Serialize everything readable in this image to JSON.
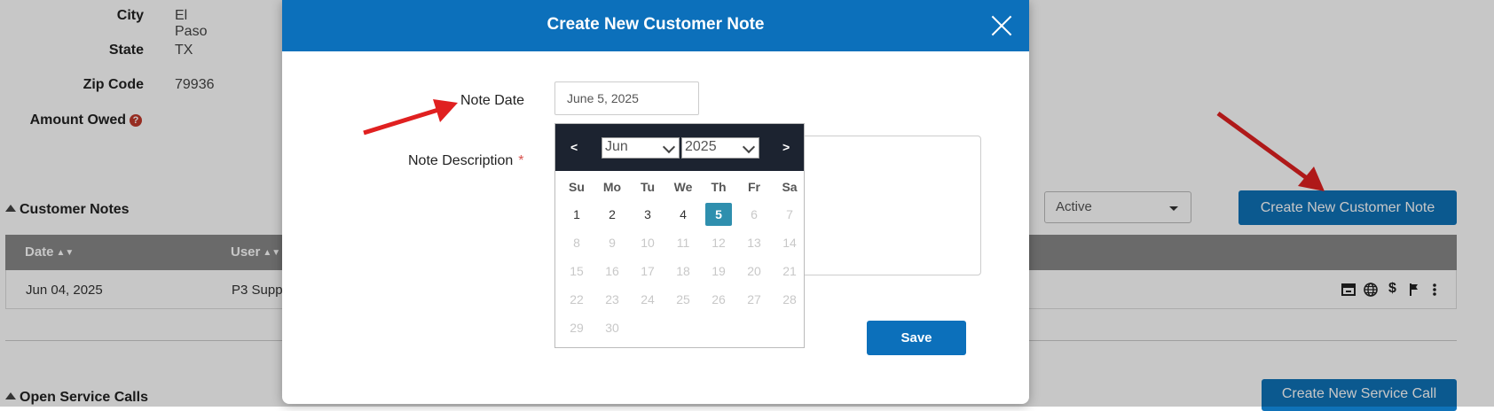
{
  "customer_info": [
    {
      "label": "City",
      "value": "El Paso"
    },
    {
      "label": "State",
      "value": "TX"
    },
    {
      "label": "Zip Code",
      "value": "79936"
    },
    {
      "label": "Amount Owed",
      "value": ""
    }
  ],
  "customer_notes": {
    "title": "Customer Notes",
    "filter_value": "Active",
    "create_button": "Create New Customer Note",
    "columns": [
      "Date",
      "User"
    ],
    "rows": [
      {
        "date": "Jun 04, 2025",
        "user": "P3 Supp"
      }
    ]
  },
  "service_calls": {
    "title": "Open Service Calls",
    "create_button": "Create New Service Call"
  },
  "modal": {
    "title": "Create New Customer Note",
    "note_date_label": "Note Date",
    "note_date_value": "June 5, 2025",
    "note_description_label": "Note Description",
    "required_mark": "*",
    "save_label": "Save"
  },
  "datepicker": {
    "prev": "<",
    "next": ">",
    "month": "Jun",
    "year": "2025",
    "weekdays": [
      "Su",
      "Mo",
      "Tu",
      "We",
      "Th",
      "Fr",
      "Sa"
    ],
    "selected_day": 5,
    "last_enabled_day": 5,
    "days_in_month": 30,
    "first_weekday_index": 0
  },
  "colors": {
    "primary": "#0c70bb",
    "datepicker_header": "#1c2330",
    "selected_day": "#2f8fae",
    "arrow": "#e02020",
    "help_icon": "#c0392b"
  }
}
